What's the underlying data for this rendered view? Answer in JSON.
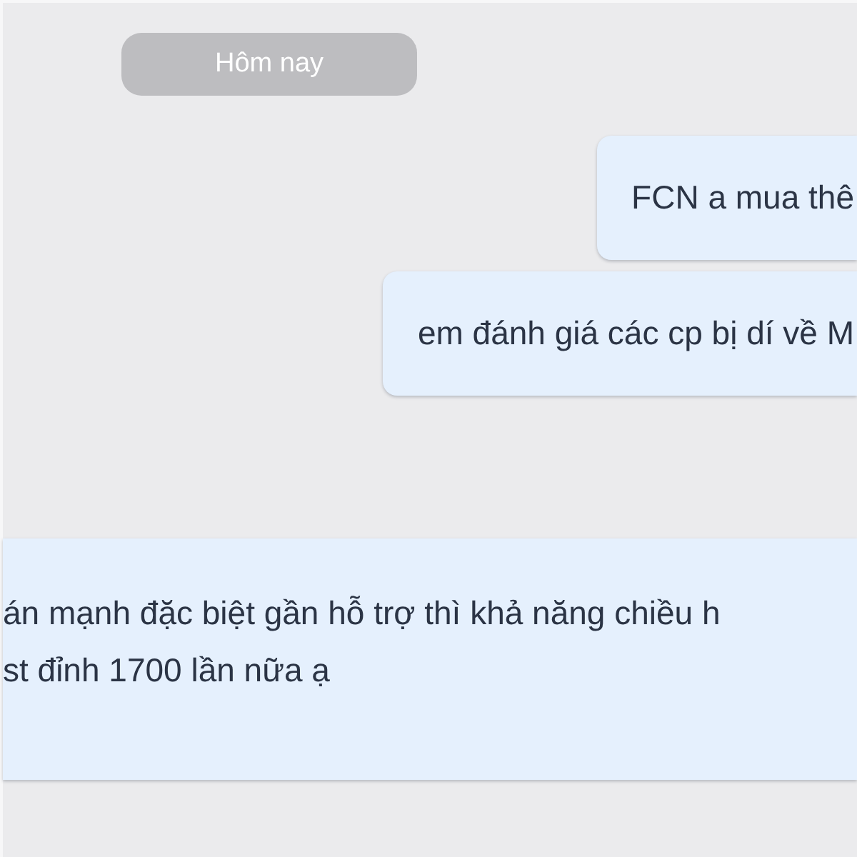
{
  "date_divider": {
    "label": "Hôm nay"
  },
  "messages": [
    {
      "lines": [
        "FCN a mua thê"
      ]
    },
    {
      "lines": [
        "em đánh giá các cp bị dí về M"
      ]
    },
    {
      "lines": [
        "án mạnh đặc biệt gần hỗ trợ thì khả năng chiều h",
        "st đỉnh 1700 lần nữa ạ"
      ]
    }
  ]
}
